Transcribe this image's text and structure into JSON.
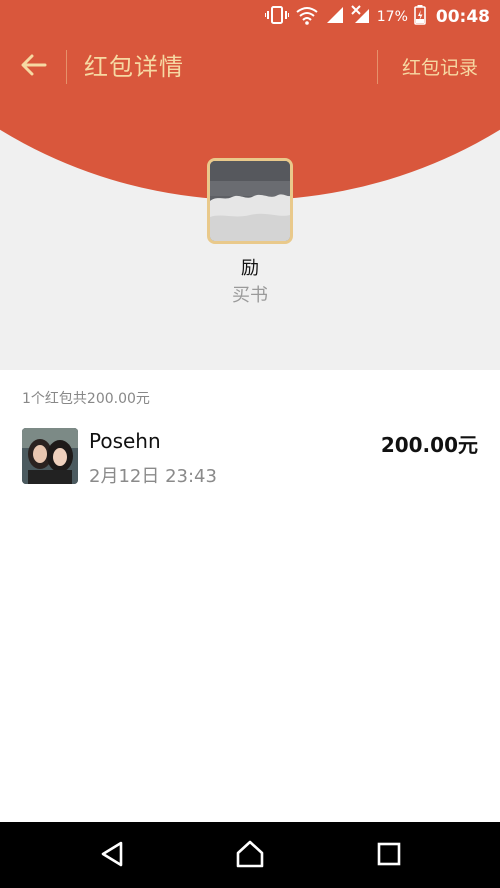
{
  "status_bar": {
    "battery_percent": "17%",
    "time": "00:48"
  },
  "header": {
    "title": "红包详情",
    "records_label": "红包记录"
  },
  "sender": {
    "name": "励",
    "wish": "买书"
  },
  "summary": "1个红包共200.00元",
  "records": [
    {
      "name": "Posehn",
      "time": "2月12日  23:43",
      "amount": "200.00元"
    }
  ],
  "colors": {
    "header_red": "#d9573c",
    "accent_gold": "#f6d9a3",
    "avatar_border": "#e9c98b"
  }
}
